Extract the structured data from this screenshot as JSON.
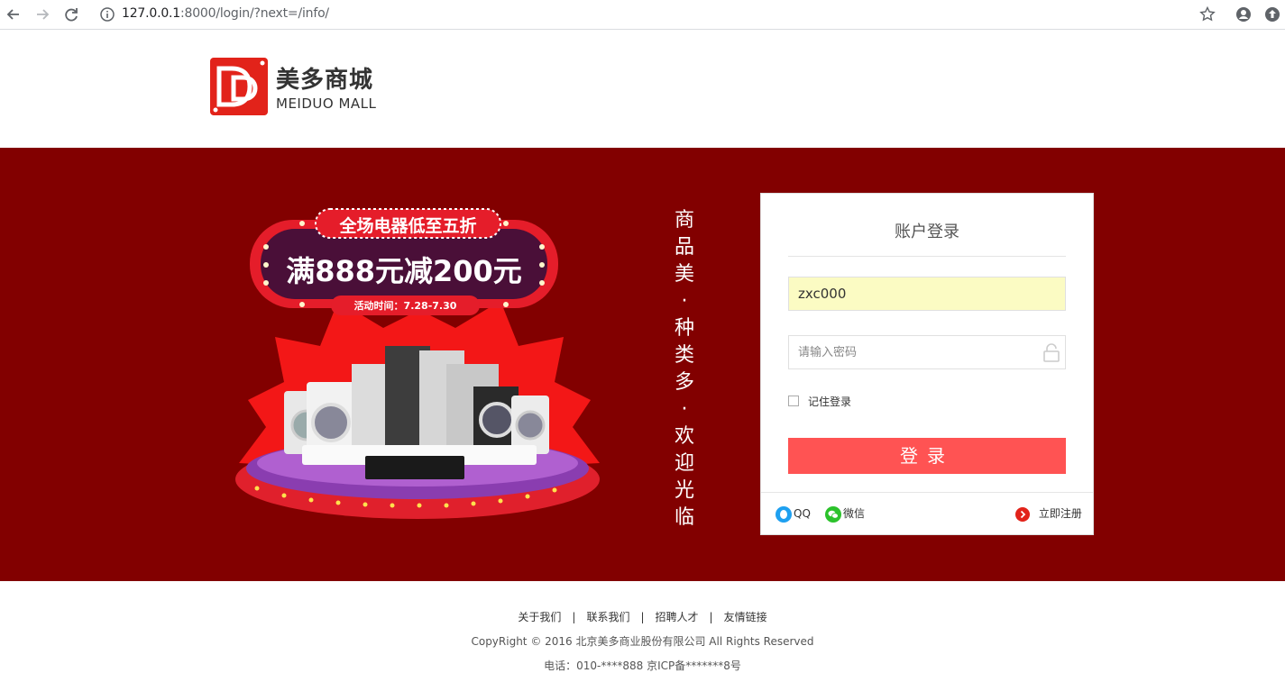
{
  "browser": {
    "url_host": "127.0.0.1",
    "url_rest": ":8000/login/?next=/info/"
  },
  "header": {
    "logo_cn": "美多商城",
    "logo_en": "MEIDUO MALL"
  },
  "promo": {
    "badge": "全场电器低至五折",
    "headline": "满888元减200元",
    "period": "活动时间：7.28-7.30"
  },
  "slogan": [
    "商",
    "品",
    "美",
    "·",
    "种",
    "类",
    "多",
    "·",
    "欢",
    "迎",
    "光",
    "临"
  ],
  "login": {
    "title": "账户登录",
    "username_value": "zxc000",
    "password_placeholder": "请输入密码",
    "remember_label": "记住登录",
    "submit_label": "登录",
    "qq_label": "QQ",
    "wechat_label": "微信",
    "register_label": "立即注册"
  },
  "footer": {
    "links": [
      "关于我们",
      "联系我们",
      "招聘人才",
      "友情链接"
    ],
    "copyright": "CopyRight © 2016 北京美多商业股份有限公司 All Rights Reserved",
    "contact": "电话：010-****888 京ICP备*******8号"
  },
  "colors": {
    "brand_red": "#e2231a",
    "banner_bg": "#820000",
    "button_red": "#ff5353",
    "autofill_yellow": "#fbfbc3"
  }
}
